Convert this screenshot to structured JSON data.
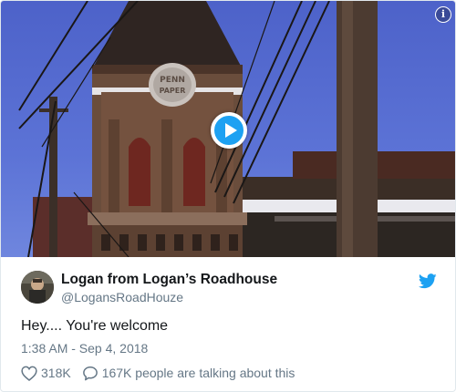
{
  "tweet": {
    "display_name": "Logan from Logan’s Roadhouse",
    "handle": "@LogansRoadHouze",
    "text": "Hey.... You're welcome",
    "timestamp": "1:38 AM - Sep 4, 2018",
    "likes": "318K",
    "replies_text": "167K people are talking about this"
  },
  "media": {
    "sign_line1": "PENN",
    "sign_line2": "PAPER",
    "info_glyph": "i",
    "play_icon": "play-icon"
  },
  "icons": {
    "info": "info-icon",
    "bird": "twitter-bird-icon",
    "like": "heart-icon",
    "reply": "speech-bubble-icon"
  },
  "colors": {
    "accent": "#1da1f2",
    "secondary_text": "#657786",
    "primary_text": "#14171a",
    "border": "#e1e8ed"
  }
}
